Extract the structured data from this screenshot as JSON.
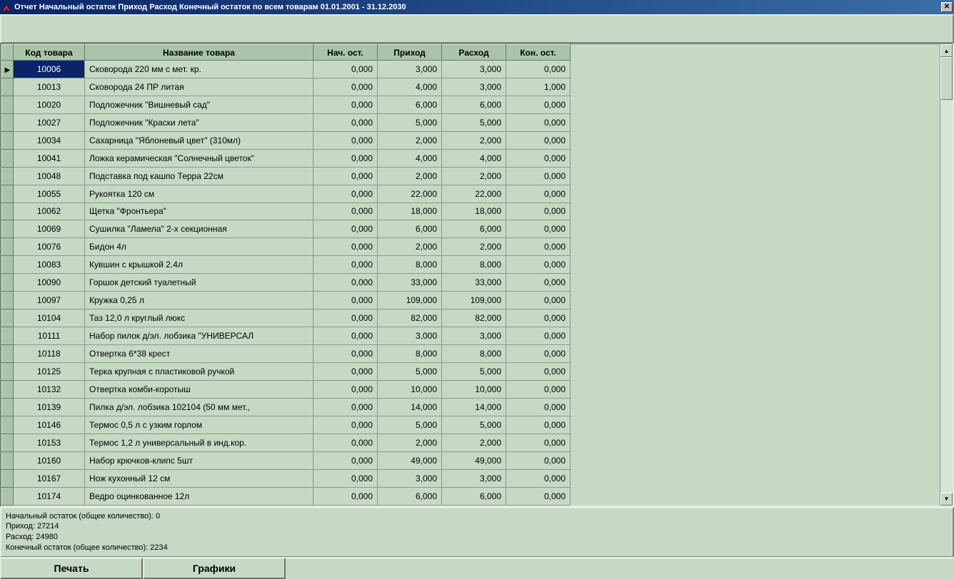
{
  "window": {
    "title": "Отчет Начальный остаток Приход Расход Конечный остаток по всем товарам   01.01.2001 - 31.12.2030"
  },
  "columns": {
    "code": "Код товара",
    "name": "Название товара",
    "start": "Нач. ост.",
    "in": "Приход",
    "out": "Расход",
    "end": "Кон. ост."
  },
  "rows": [
    {
      "code": "10006",
      "name": "Сковорода 220 мм с мет. кр.",
      "start": "0,000",
      "in": "3,000",
      "out": "3,000",
      "end": "0,000",
      "selected": true
    },
    {
      "code": "10013",
      "name": "Сковорода 24 ПР литая",
      "start": "0,000",
      "in": "4,000",
      "out": "3,000",
      "end": "1,000"
    },
    {
      "code": "10020",
      "name": "Подложечник \"Вишневый сад\"",
      "start": "0,000",
      "in": "6,000",
      "out": "6,000",
      "end": "0,000"
    },
    {
      "code": "10027",
      "name": "Подложечник \"Краски лета\"",
      "start": "0,000",
      "in": "5,000",
      "out": "5,000",
      "end": "0,000"
    },
    {
      "code": "10034",
      "name": "Сахарница \"Яблоневый цвет\" (310мл)",
      "start": "0,000",
      "in": "2,000",
      "out": "2,000",
      "end": "0,000"
    },
    {
      "code": "10041",
      "name": "Ложка керамическая \"Солнечный цветок\"",
      "start": "0,000",
      "in": "4,000",
      "out": "4,000",
      "end": "0,000"
    },
    {
      "code": "10048",
      "name": "Подставка под кашпо Терра 22см",
      "start": "0,000",
      "in": "2,000",
      "out": "2,000",
      "end": "0,000"
    },
    {
      "code": "10055",
      "name": "Рукоятка 120 см",
      "start": "0,000",
      "in": "22,000",
      "out": "22,000",
      "end": "0,000"
    },
    {
      "code": "10062",
      "name": "Щетка \"Фронтьера\"",
      "start": "0,000",
      "in": "18,000",
      "out": "18,000",
      "end": "0,000"
    },
    {
      "code": "10069",
      "name": "Сушилка \"Ламела\" 2-х секционная",
      "start": "0,000",
      "in": "6,000",
      "out": "6,000",
      "end": "0,000"
    },
    {
      "code": "10076",
      "name": "Бидон 4л",
      "start": "0,000",
      "in": "2,000",
      "out": "2,000",
      "end": "0,000"
    },
    {
      "code": "10083",
      "name": "Кувшин с крышкой 2.4л",
      "start": "0,000",
      "in": "8,000",
      "out": "8,000",
      "end": "0,000"
    },
    {
      "code": "10090",
      "name": "Горшок детский туалетный",
      "start": "0,000",
      "in": "33,000",
      "out": "33,000",
      "end": "0,000"
    },
    {
      "code": "10097",
      "name": "Кружка 0,25 л",
      "start": "0,000",
      "in": "109,000",
      "out": "109,000",
      "end": "0,000"
    },
    {
      "code": "10104",
      "name": "Таз 12,0 л круглый люкс",
      "start": "0,000",
      "in": "82,000",
      "out": "82,000",
      "end": "0,000"
    },
    {
      "code": "10111",
      "name": "Набор пилок д/эл. лобзика \"УНИВЕРСАЛ",
      "start": "0,000",
      "in": "3,000",
      "out": "3,000",
      "end": "0,000"
    },
    {
      "code": "10118",
      "name": "Отвертка 6*38 крест",
      "start": "0,000",
      "in": "8,000",
      "out": "8,000",
      "end": "0,000"
    },
    {
      "code": "10125",
      "name": "Терка крупная с пластиковой ручкой",
      "start": "0,000",
      "in": "5,000",
      "out": "5,000",
      "end": "0,000"
    },
    {
      "code": "10132",
      "name": "Отвертка комби-коротыш",
      "start": "0,000",
      "in": "10,000",
      "out": "10,000",
      "end": "0,000"
    },
    {
      "code": "10139",
      "name": "Пилка д/эл. лобзика 102104 (50 мм мет.,",
      "start": "0,000",
      "in": "14,000",
      "out": "14,000",
      "end": "0,000"
    },
    {
      "code": "10146",
      "name": "Термос 0,5 л с узким горлом",
      "start": "0,000",
      "in": "5,000",
      "out": "5,000",
      "end": "0,000"
    },
    {
      "code": "10153",
      "name": "Термос 1,2 л универсальный в инд.кор.",
      "start": "0,000",
      "in": "2,000",
      "out": "2,000",
      "end": "0,000"
    },
    {
      "code": "10160",
      "name": "Набор крючков-клипс 5шт",
      "start": "0,000",
      "in": "49,000",
      "out": "49,000",
      "end": "0,000"
    },
    {
      "code": "10167",
      "name": "Нож кухонный 12 см",
      "start": "0,000",
      "in": "3,000",
      "out": "3,000",
      "end": "0,000"
    },
    {
      "code": "10174",
      "name": "Ведро оцинкованное 12л",
      "start": "0,000",
      "in": "6,000",
      "out": "6,000",
      "end": "0,000"
    }
  ],
  "summary": {
    "line1": "Начальный остаток (общее количество): 0",
    "line2": "Приход: 27214",
    "line3": "Расход: 24980",
    "line4": "Конечный остаток (общее количество): 2234"
  },
  "buttons": {
    "print": "Печать",
    "charts": "Графики"
  }
}
